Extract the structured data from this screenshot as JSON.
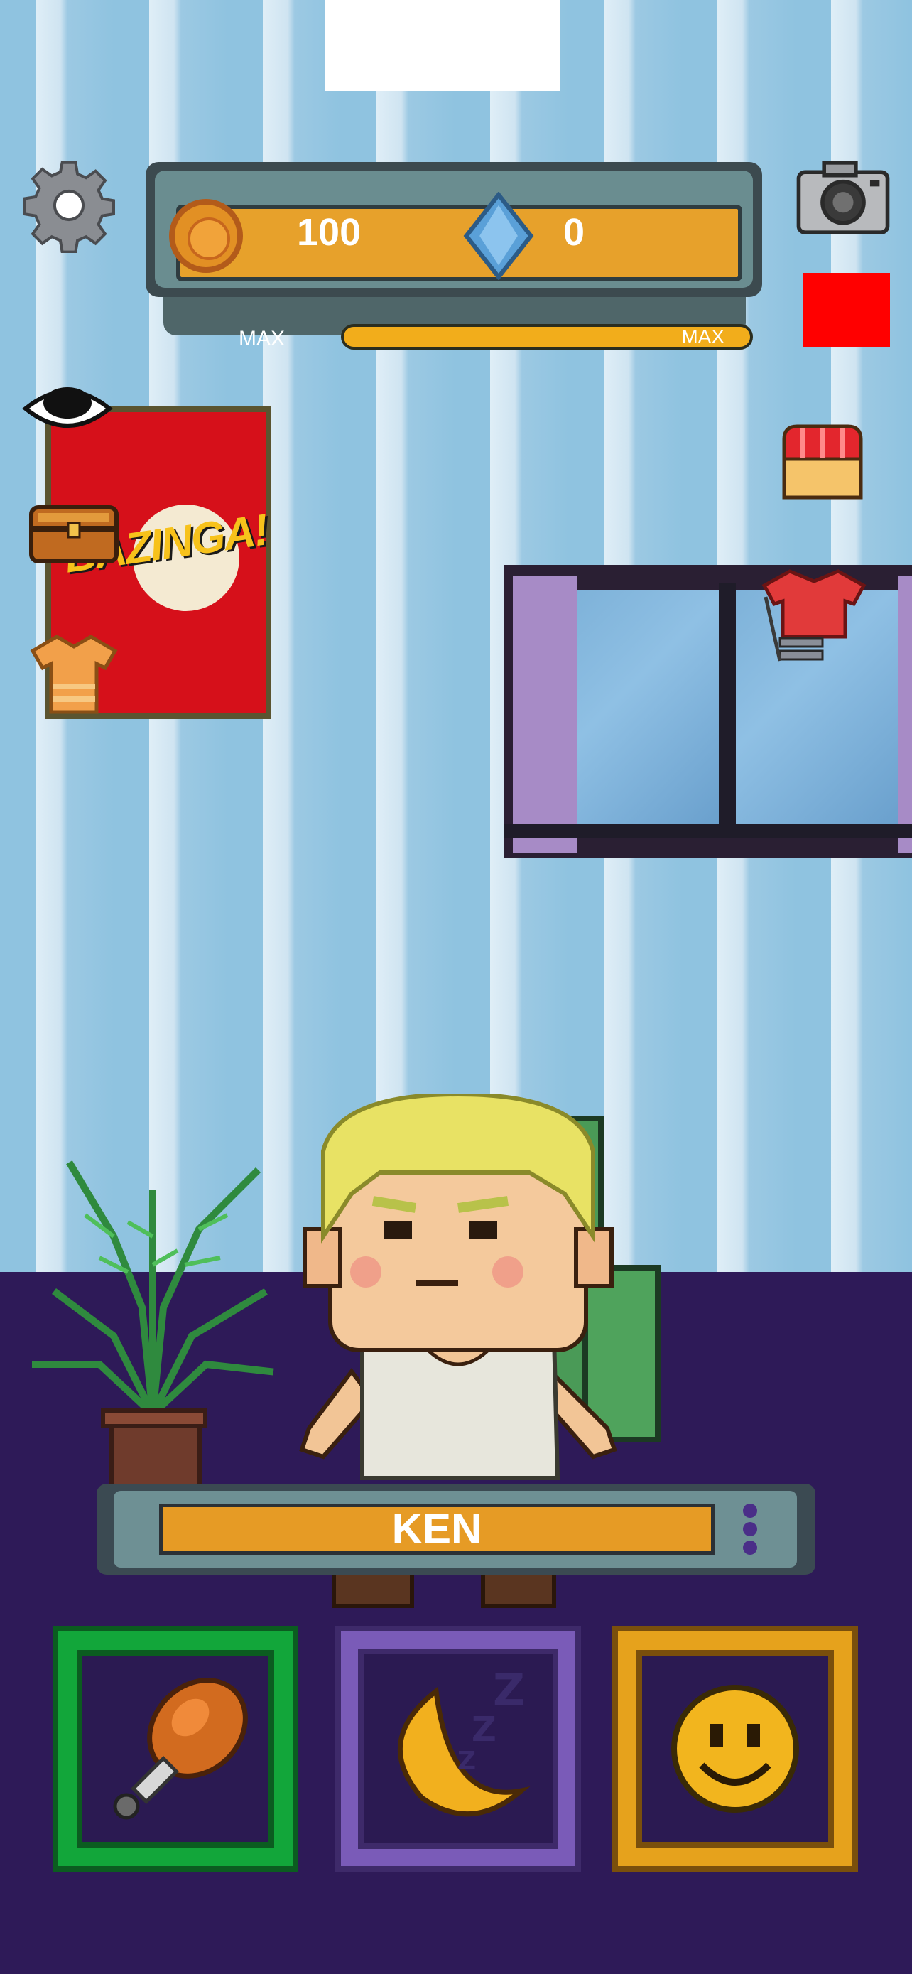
{
  "currency": {
    "coins": "100",
    "gems": "0"
  },
  "level": {
    "left_label": "MAX",
    "bar_label": "MAX",
    "progress": 1.0
  },
  "poster": {
    "text": "BAZINGA!"
  },
  "pet": {
    "name": "KEN"
  },
  "icons": {
    "settings": "gear-icon",
    "camera": "camera-icon",
    "eye": "eye-icon",
    "chest": "treasure-chest-icon",
    "shirt": "shirt-icon",
    "shop": "shop-icon",
    "clothes": "clothes-rack-icon",
    "food": "drumstick-icon",
    "sleep": "moon-zzz-icon",
    "play": "smiley-icon"
  },
  "colors": {
    "wall": "#8fc3e0",
    "floor": "#2e1a58",
    "food_button": "#12a63a",
    "sleep_button": "#7a5bb8",
    "play_button": "#e6a21c",
    "bar_fill": "#e7a12b"
  }
}
